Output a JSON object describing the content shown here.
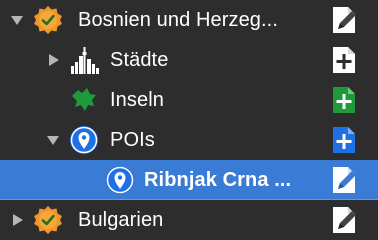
{
  "tree": {
    "rows": [
      {
        "label": "Bosnien und Herzeg...",
        "icon": "badge-icon",
        "disclosure": "expanded",
        "action_icon": "edit-icon",
        "selected": false
      },
      {
        "label": "Städte",
        "icon": "city-skyline-icon",
        "disclosure": "collapsed",
        "action_icon": "add-icon",
        "selected": false
      },
      {
        "label": "Inseln",
        "icon": "island-icon",
        "disclosure": "none",
        "action_icon": "add-icon",
        "selected": false
      },
      {
        "label": "POIs",
        "icon": "map-pin-icon",
        "disclosure": "expanded",
        "action_icon": "add-icon",
        "selected": false
      },
      {
        "label": "Ribnjak Crna ...",
        "icon": "map-pin-icon",
        "disclosure": "none",
        "action_icon": "edit-icon",
        "selected": true
      },
      {
        "label": "Bulgarien",
        "icon": "badge-icon",
        "disclosure": "collapsed",
        "action_icon": "edit-icon",
        "selected": false
      }
    ]
  },
  "colors": {
    "background": "#2d2d2d",
    "selection": "#3a7bd5",
    "pin_blue": "#1f6fe5",
    "island_green": "#1f9a3a",
    "badge_orange": "#f0962a",
    "add_green": "#1f9a3a",
    "add_blue": "#1f6fe5"
  }
}
